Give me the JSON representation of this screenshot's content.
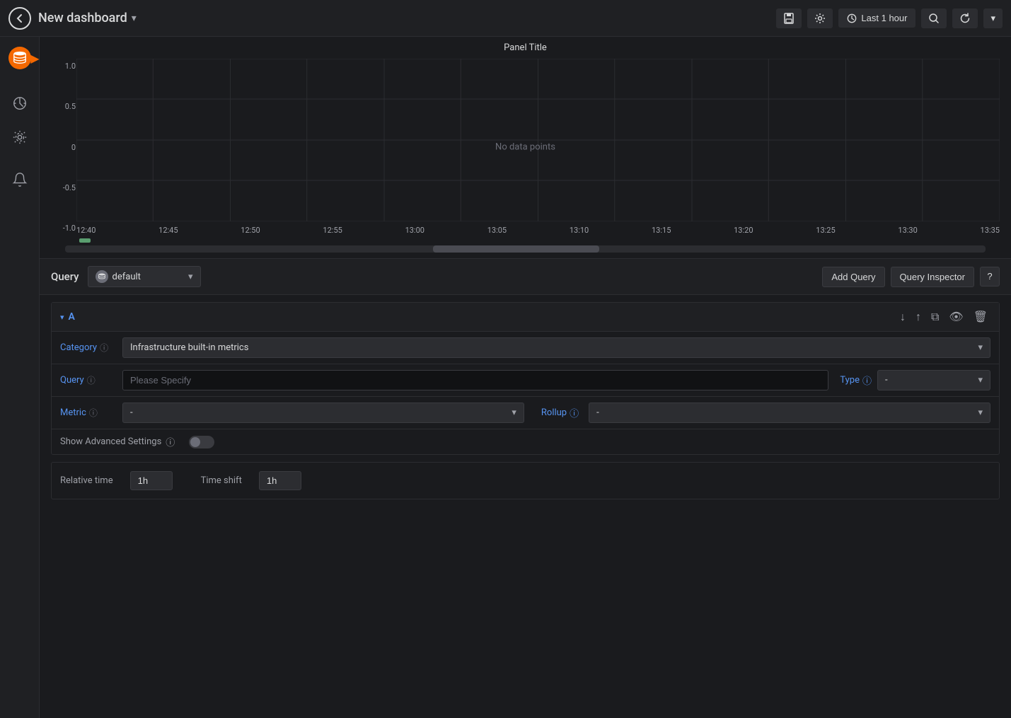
{
  "topbar": {
    "title": "New dashboard",
    "title_arrow": "▾",
    "back_label": "back",
    "time_range": "Last 1 hour",
    "save_label": "💾",
    "settings_label": "⚙",
    "search_label": "🔍",
    "refresh_label": "↺",
    "more_label": "▾"
  },
  "chart": {
    "panel_title": "Panel Title",
    "no_data": "No data points",
    "y_axis": [
      "1.0",
      "0.5",
      "0",
      "-0.5",
      "-1.0"
    ],
    "x_axis": [
      "12:40",
      "12:45",
      "12:50",
      "12:55",
      "13:00",
      "13:05",
      "13:10",
      "13:15",
      "13:20",
      "13:25",
      "13:30",
      "13:35"
    ]
  },
  "sidebar": {
    "items": [
      {
        "id": "datasource",
        "label": "Datasource icon"
      },
      {
        "id": "chart",
        "label": "Chart icon"
      },
      {
        "id": "settings",
        "label": "Settings icon"
      },
      {
        "id": "notifications",
        "label": "Notifications icon"
      }
    ]
  },
  "query": {
    "label": "Query",
    "datasource": "default",
    "add_query_label": "Add Query",
    "query_inspector_label": "Query Inspector",
    "help_label": "?",
    "section_a": {
      "id": "A",
      "category_label": "Category",
      "category_value": "Infrastructure built-in metrics",
      "query_label": "Query",
      "query_placeholder": "Please Specify",
      "type_label": "Type",
      "type_value": "-",
      "metric_label": "Metric",
      "metric_value": "-",
      "rollup_label": "Rollup",
      "rollup_value": "-",
      "advanced_label": "Show Advanced Settings"
    },
    "relative_time_label": "Relative time",
    "relative_time_value": "1h",
    "time_shift_label": "Time shift",
    "time_shift_value": "1h"
  }
}
